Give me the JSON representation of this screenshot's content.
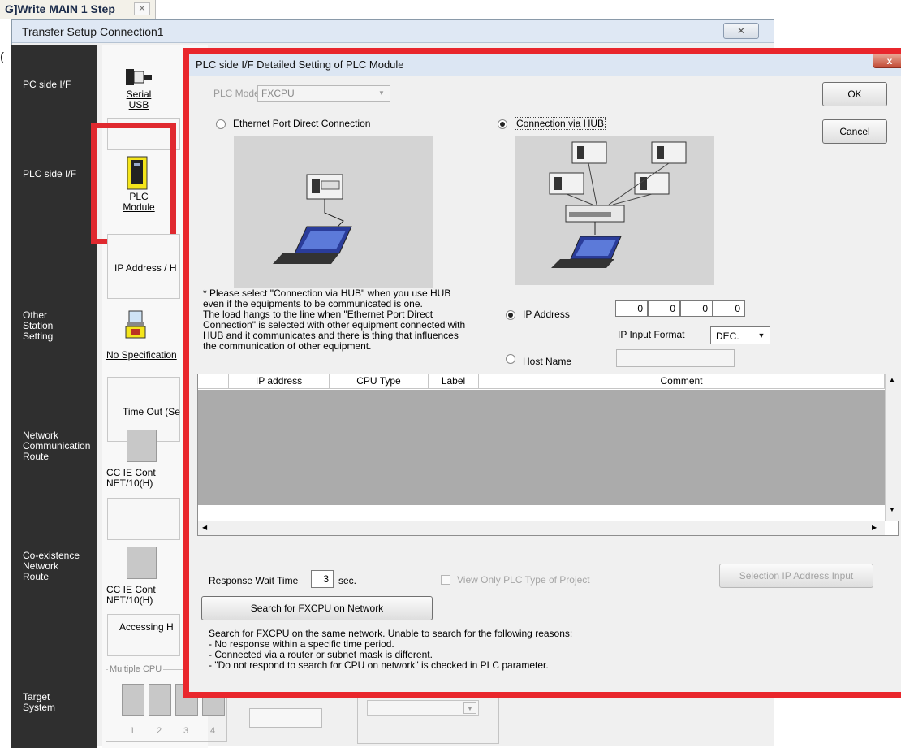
{
  "top_tab": {
    "title": "G]Write MAIN 1 Step",
    "close": "✕"
  },
  "paren": "(",
  "transfer_setup": {
    "title": "Transfer Setup Connection1",
    "close": "✕",
    "sidebar": {
      "pc_side": "PC side I/F",
      "plc_side": "PLC side I/F",
      "other_station": [
        "Other",
        "Station",
        "Setting"
      ],
      "network_route": [
        "Network",
        "Communication",
        "Route"
      ],
      "coexistence": [
        "Co-existence",
        "Network",
        "Route"
      ],
      "target": [
        "Target",
        "System"
      ]
    },
    "serial_usb": [
      "Serial",
      "USB"
    ],
    "plc_module": [
      "PLC",
      "Module"
    ],
    "ip_address_partial": "IP Address / H",
    "no_specification": "No Specification",
    "timeout_partial": "Time Out (Se",
    "cc_ie_1": [
      "CC IE Cont",
      "NET/10(H)"
    ],
    "cc_ie_2": [
      "CC IE Cont",
      "NET/10(H)"
    ],
    "accessing_partial": "Accessing H",
    "multiple_cpu": "Multiple CPU",
    "cpu_numbers": [
      "1",
      "2",
      "3",
      "4"
    ]
  },
  "dialog": {
    "title": "PLC side I/F Detailed Setting of PLC Module",
    "close": "x",
    "plc_mode_label": "PLC Mode",
    "plc_mode_value": "FXCPU",
    "radio_direct": "Ethernet Port Direct Connection",
    "radio_hub": "Connection via HUB",
    "ok": "OK",
    "cancel": "Cancel",
    "note": [
      "* Please select \"Connection via HUB\" when you use HUB",
      "even if the equipments to be communicated is one.",
      "The load hangs to the line when \"Ethernet Port Direct",
      "Connection\" is selected with other equipment connected with",
      "HUB and it communicates and there is thing that influences",
      "the communication of other equipment."
    ],
    "ip_address_label": "IP Address",
    "ip_octets": [
      "0",
      "0",
      "0",
      "0"
    ],
    "ip_format_label": "IP Input Format",
    "ip_format_value": "DEC.",
    "host_name_label": "Host Name",
    "table": {
      "columns": [
        "",
        "IP address",
        "CPU Type",
        "Label",
        "Comment"
      ],
      "rows": []
    },
    "response_wait_label": "Response Wait Time",
    "response_wait_value": "3",
    "response_wait_unit": "sec.",
    "view_only_label": "View Only PLC Type of Project",
    "selection_ip_button": "Selection IP Address Input",
    "search_button": "Search for FXCPU on Network",
    "search_info": [
      "Search for FXCPU on the same network. Unable to search for the following reasons:",
      "- No response within a specific time period.",
      "- Connected via a router or subnet mask is different.",
      "- \"Do not respond to search for CPU on network\" is checked in PLC parameter."
    ]
  },
  "colors": {
    "highlight": "#e9262c",
    "sidebar": "#2f2f2f",
    "grid_body": "#ababab"
  }
}
